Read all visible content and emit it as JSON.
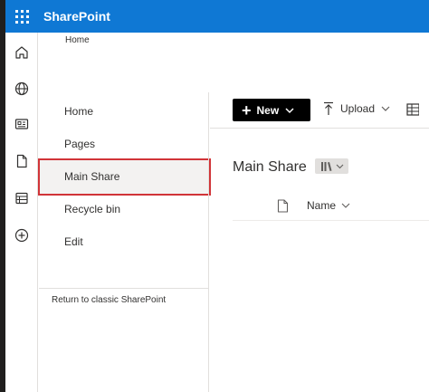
{
  "suite_bar": {
    "app_name": "SharePoint"
  },
  "breadcrumb": {
    "text": "Home"
  },
  "rail_icons": [
    "home-icon",
    "globe-icon",
    "news-icon",
    "document-icon",
    "list-icon",
    "add-circle-icon"
  ],
  "left_nav": {
    "items": [
      {
        "label": "Home"
      },
      {
        "label": "Pages"
      },
      {
        "label": "Main Share",
        "selected": true
      },
      {
        "label": "Recycle bin"
      },
      {
        "label": "Edit"
      }
    ],
    "classic_link": "Return to classic SharePoint"
  },
  "command_bar": {
    "new_label": "New",
    "upload_label": "Upload"
  },
  "library": {
    "title": "Main Share",
    "columns": [
      {
        "label": "Name"
      }
    ]
  },
  "colors": {
    "suite_bar": "#0f78d4",
    "highlight_border": "#d13438",
    "new_button": "#000000"
  }
}
